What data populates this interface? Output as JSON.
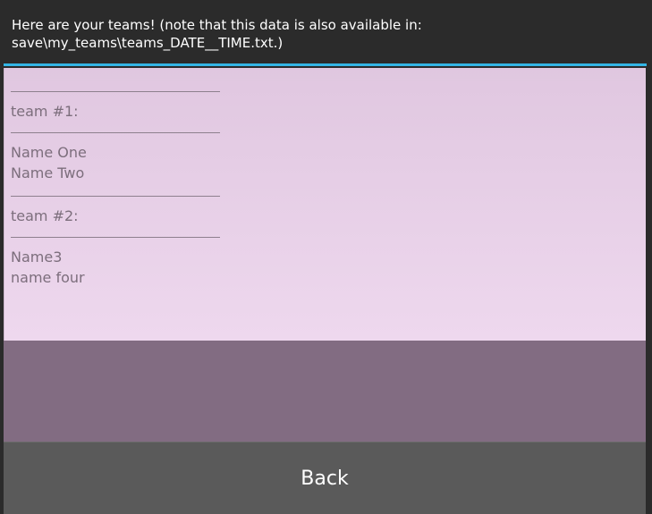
{
  "header": {
    "line1": "Here are your teams! (note that this data is also available in:",
    "line2": "save\\my_teams\\teams_DATE__TIME.txt.)"
  },
  "teams": [
    {
      "label": "team #1:",
      "members": [
        "Name One",
        "Name Two"
      ]
    },
    {
      "label": "team #2:",
      "members": [
        "Name3",
        "name four"
      ]
    }
  ],
  "footer": {
    "back_label": "Back"
  },
  "colors": {
    "accent": "#33b5e5",
    "content_bg": "#e6cfe6",
    "filler_bg": "#826c82",
    "button_bg": "#5a5a5a"
  }
}
